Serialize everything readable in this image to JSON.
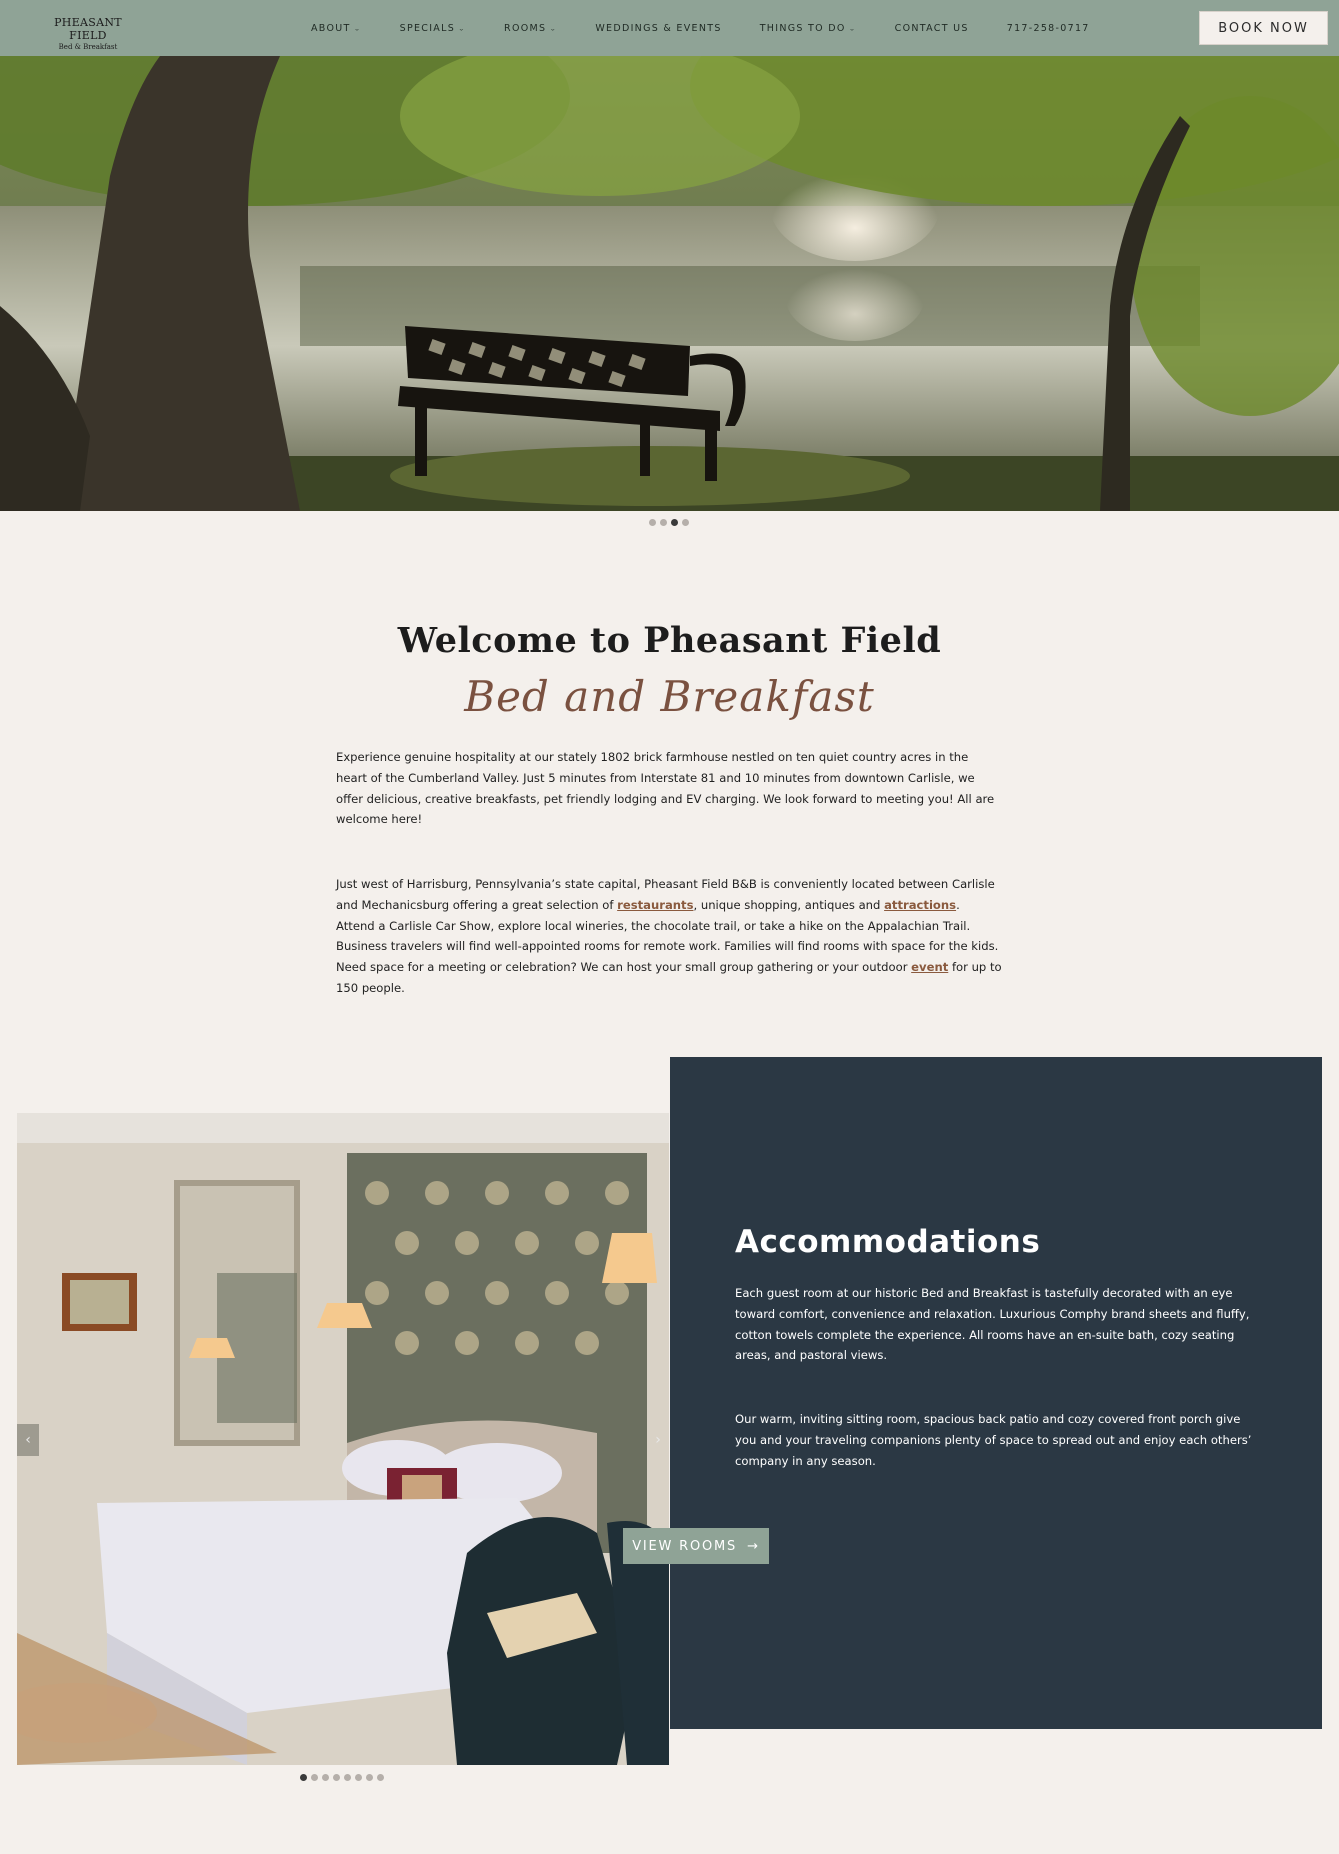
{
  "header": {
    "logo_title": "PHEASANT FIELD",
    "logo_subtitle": "Bed & Breakfast",
    "nav": [
      {
        "label": "ABOUT",
        "dropdown": true
      },
      {
        "label": "SPECIALS",
        "dropdown": true
      },
      {
        "label": "ROOMS",
        "dropdown": true
      },
      {
        "label": "WEDDINGS & EVENTS",
        "dropdown": false
      },
      {
        "label": "THINGS TO DO",
        "dropdown": true
      },
      {
        "label": "CONTACT US",
        "dropdown": false
      },
      {
        "label": "717-258-0717",
        "dropdown": false
      }
    ],
    "book_label": "BOOK NOW"
  },
  "hero": {
    "slides": 4,
    "active_slide": 3
  },
  "welcome": {
    "title": "Welcome to Pheasant Field",
    "script": "Bed and Breakfast",
    "para1": "Experience genuine hospitality at our stately 1802 brick farmhouse nestled on ten quiet country acres in the heart of the Cumberland Valley. Just 5 minutes from Interstate 81 and 10 minutes from downtown Carlisle, we offer delicious, creative breakfasts, pet friendly lodging and EV charging. We look forward to meeting you! All are welcome here!",
    "para2_a": "Just west of Harrisburg, Pennsylvania’s state capital, Pheasant Field B&B is conveniently located between Carlisle and Mechanicsburg offering a great selection of ",
    "link_restaurants": "restaurants",
    "para2_b": ", unique shopping, antiques and ",
    "link_attractions": "attractions",
    "para2_c": ".  Attend a Carlisle Car Show, explore local wineries, the chocolate trail, or take a hike on the Appalachian Trail.  Business travelers will find well-appointed rooms for remote work.  Families will find rooms with space for the kids.  Need space for a meeting or celebration?  We can host your small group gathering or your outdoor ",
    "link_event": "event",
    "para2_d": " for up to 150 people."
  },
  "accommodations": {
    "title": "Accommodations",
    "para1": "Each guest room at our historic Bed and Breakfast is tastefully decorated with an eye toward comfort, convenience and relaxation. Luxurious Comphy brand sheets and fluffy, cotton towels complete the experience. All rooms have an en-suite bath, cozy seating areas, and pastoral views.",
    "para2": "Our warm, inviting sitting room, spacious back patio and cozy covered front porch give you and your traveling companions plenty of space to spread out and enjoy each others’ company in any season.",
    "button_label": "VIEW ROOMS",
    "slides": 8,
    "active_slide": 1
  },
  "colors": {
    "header_bg": "#8fa396",
    "page_bg": "#f4f0ec",
    "panel_bg": "#2b3844",
    "link": "#8a5a3e",
    "script": "#7a5140"
  },
  "icons": {
    "chevron": "chevron-down-icon",
    "arrow": "arrow-right-icon",
    "prev": "chevron-left-icon",
    "next": "chevron-right-icon"
  }
}
